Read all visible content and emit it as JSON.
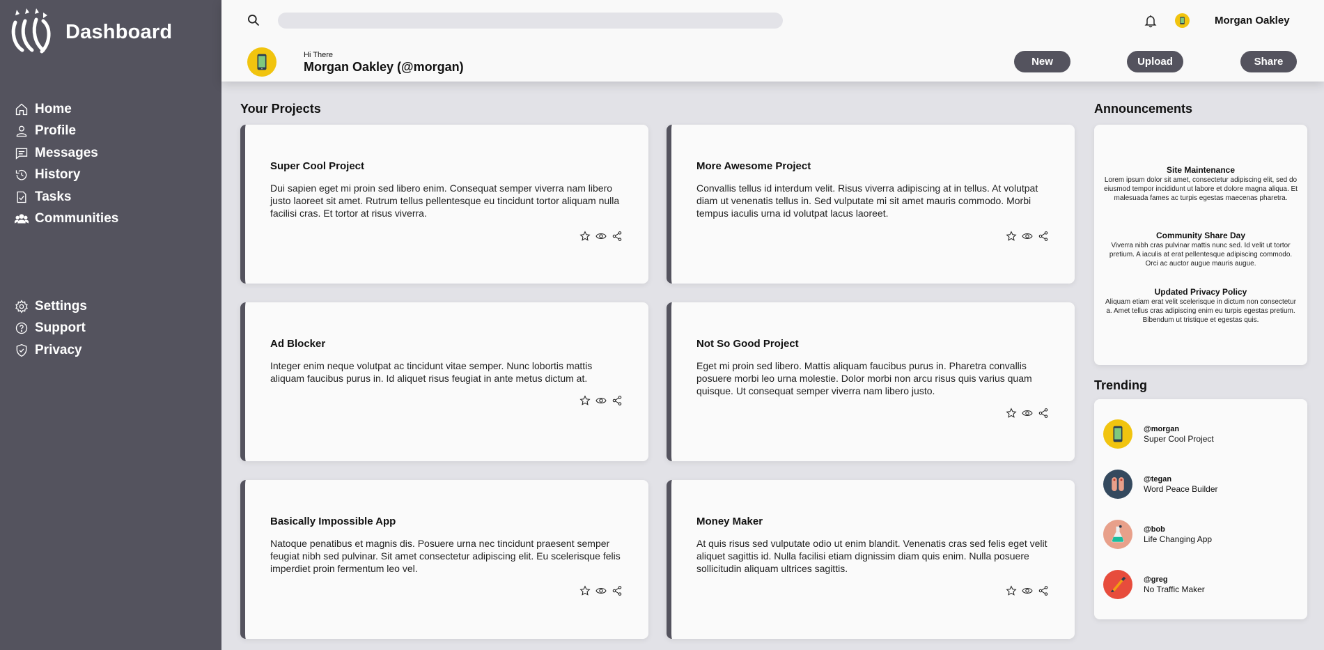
{
  "sidebar": {
    "title": "Dashboard",
    "main_items": [
      {
        "label": "Home",
        "icon": "home-icon"
      },
      {
        "label": "Profile",
        "icon": "user-icon"
      },
      {
        "label": "Messages",
        "icon": "message-icon"
      },
      {
        "label": "History",
        "icon": "history-icon"
      },
      {
        "label": "Tasks",
        "icon": "tasks-icon"
      },
      {
        "label": "Communities",
        "icon": "communities-icon"
      }
    ],
    "bottom_items": [
      {
        "label": "Settings",
        "icon": "gear-icon"
      },
      {
        "label": "Support",
        "icon": "help-icon"
      },
      {
        "label": "Privacy",
        "icon": "shield-icon"
      }
    ]
  },
  "header": {
    "search_placeholder": "",
    "user_name": "Morgan Oakley",
    "greeting": "Hi There",
    "display_name": "Morgan Oakley (@morgan)",
    "buttons": {
      "new": "New",
      "upload": "Upload",
      "share": "Share"
    }
  },
  "projects": {
    "title": "Your Projects",
    "items": [
      {
        "title": "Super Cool Project",
        "desc": "Dui sapien eget mi proin sed libero enim. Consequat semper viverra nam libero justo laoreet sit amet. Rutrum tellus pellentesque eu tincidunt tortor aliquam nulla facilisi cras. Et tortor at risus viverra."
      },
      {
        "title": "More Awesome Project",
        "desc": "Convallis tellus id interdum velit. Risus viverra adipiscing at in tellus. At volutpat diam ut venenatis tellus in. Sed vulputate mi sit amet mauris commodo. Morbi tempus iaculis urna id volutpat lacus laoreet."
      },
      {
        "title": "Ad Blocker",
        "desc": "Integer enim neque volutpat ac tincidunt vitae semper. Nunc lobortis mattis aliquam faucibus purus in. Id aliquet risus feugiat in ante metus dictum at."
      },
      {
        "title": "Not So Good Project",
        "desc": "Eget mi proin sed libero. Mattis aliquam faucibus purus in. Pharetra convallis posuere morbi leo urna molestie. Dolor morbi non arcu risus quis varius quam quisque. Ut consequat semper viverra nam libero justo."
      },
      {
        "title": "Basically Impossible App",
        "desc": "Natoque penatibus et magnis dis. Posuere urna nec tincidunt praesent semper feugiat nibh sed pulvinar. Sit amet consectetur adipiscing elit. Eu scelerisque felis imperdiet proin fermentum leo vel."
      },
      {
        "title": "Money Maker",
        "desc": "At quis risus sed vulputate odio ut enim blandit. Venenatis cras sed felis eget velit aliquet sagittis id. Nulla facilisi etiam dignissim diam quis enim. Nulla posuere sollicitudin aliquam ultrices sagittis."
      }
    ]
  },
  "announcements": {
    "title": "Announcements",
    "items": [
      {
        "title": "Site Maintenance",
        "body": "Lorem ipsum dolor sit amet, consectetur adipiscing elit, sed do eiusmod tempor incididunt ut labore et dolore magna aliqua. Et malesuada fames ac turpis egestas maecenas pharetra."
      },
      {
        "title": "Community Share Day",
        "body": "Viverra nibh cras pulvinar mattis nunc sed. Id velit ut tortor pretium. A iaculis at erat pellentesque adipiscing commodo. Orci ac auctor augue mauris augue."
      },
      {
        "title": "Updated Privacy Policy",
        "body": "Aliquam etiam erat velit scelerisque in dictum non consectetur a. Amet tellus cras adipiscing enim eu turpis egestas pretium. Bibendum ut tristique et egestas quis."
      }
    ]
  },
  "trending": {
    "title": "Trending",
    "items": [
      {
        "handle": "@morgan",
        "project": "Super Cool Project",
        "avatar_color": "#f1c40f"
      },
      {
        "handle": "@tegan",
        "project": "Word Peace Builder",
        "avatar_color": "#34495e"
      },
      {
        "handle": "@bob",
        "project": "Life Changing App",
        "avatar_color": "#e8a08a"
      },
      {
        "handle": "@greg",
        "project": "No Traffic Maker",
        "avatar_color": "#e74c3c"
      }
    ]
  },
  "colors": {
    "sidebar": "#54535e",
    "accent_yellow": "#f1c40f",
    "background": "#e2e2e7",
    "card": "#fafafa"
  }
}
